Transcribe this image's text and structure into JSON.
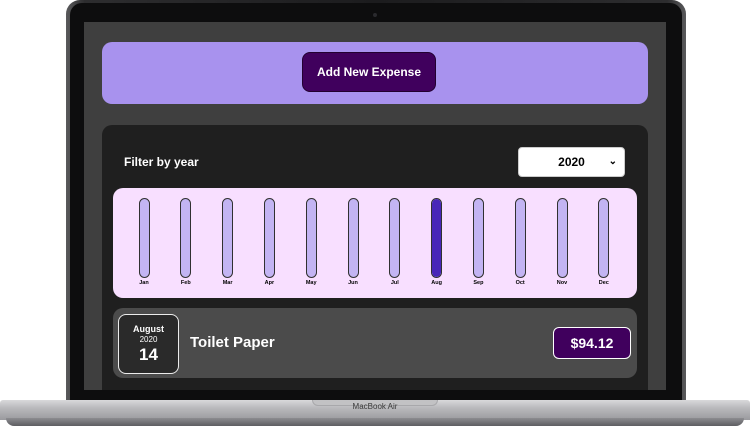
{
  "device": {
    "label": "MacBook Air"
  },
  "header": {
    "add_button_label": "Add New Expense"
  },
  "filter": {
    "label": "Filter by year",
    "selected_year": "2020"
  },
  "chart_data": {
    "type": "bar",
    "categories": [
      "Jan",
      "Feb",
      "Mar",
      "Apr",
      "May",
      "Jun",
      "Jul",
      "Aug",
      "Sep",
      "Oct",
      "Nov",
      "Dec"
    ],
    "values": [
      0,
      0,
      0,
      0,
      0,
      0,
      0,
      94.12,
      0,
      0,
      0,
      0
    ],
    "ylim": [
      0,
      94.12
    ],
    "grid": false,
    "fill_color": "#4826b9",
    "track_color": "#c3b4f3"
  },
  "expenses": [
    {
      "month": "August",
      "year": "2020",
      "day": "14",
      "title": "Toilet Paper",
      "amount": "$94.12"
    }
  ],
  "colors": {
    "accent": "#40005d",
    "header_bg": "#a892ee",
    "chart_bg": "#f8dfff"
  }
}
